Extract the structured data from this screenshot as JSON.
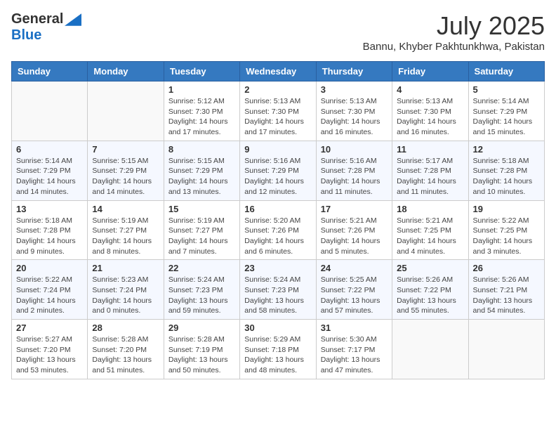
{
  "logo": {
    "general": "General",
    "blue": "Blue"
  },
  "title": "July 2025",
  "subtitle": "Bannu, Khyber Pakhtunkhwa, Pakistan",
  "days_of_week": [
    "Sunday",
    "Monday",
    "Tuesday",
    "Wednesday",
    "Thursday",
    "Friday",
    "Saturday"
  ],
  "weeks": [
    [
      {
        "day": "",
        "sunrise": "",
        "sunset": "",
        "daylight": ""
      },
      {
        "day": "",
        "sunrise": "",
        "sunset": "",
        "daylight": ""
      },
      {
        "day": "1",
        "sunrise": "Sunrise: 5:12 AM",
        "sunset": "Sunset: 7:30 PM",
        "daylight": "Daylight: 14 hours and 17 minutes."
      },
      {
        "day": "2",
        "sunrise": "Sunrise: 5:13 AM",
        "sunset": "Sunset: 7:30 PM",
        "daylight": "Daylight: 14 hours and 17 minutes."
      },
      {
        "day": "3",
        "sunrise": "Sunrise: 5:13 AM",
        "sunset": "Sunset: 7:30 PM",
        "daylight": "Daylight: 14 hours and 16 minutes."
      },
      {
        "day": "4",
        "sunrise": "Sunrise: 5:13 AM",
        "sunset": "Sunset: 7:30 PM",
        "daylight": "Daylight: 14 hours and 16 minutes."
      },
      {
        "day": "5",
        "sunrise": "Sunrise: 5:14 AM",
        "sunset": "Sunset: 7:29 PM",
        "daylight": "Daylight: 14 hours and 15 minutes."
      }
    ],
    [
      {
        "day": "6",
        "sunrise": "Sunrise: 5:14 AM",
        "sunset": "Sunset: 7:29 PM",
        "daylight": "Daylight: 14 hours and 14 minutes."
      },
      {
        "day": "7",
        "sunrise": "Sunrise: 5:15 AM",
        "sunset": "Sunset: 7:29 PM",
        "daylight": "Daylight: 14 hours and 14 minutes."
      },
      {
        "day": "8",
        "sunrise": "Sunrise: 5:15 AM",
        "sunset": "Sunset: 7:29 PM",
        "daylight": "Daylight: 14 hours and 13 minutes."
      },
      {
        "day": "9",
        "sunrise": "Sunrise: 5:16 AM",
        "sunset": "Sunset: 7:29 PM",
        "daylight": "Daylight: 14 hours and 12 minutes."
      },
      {
        "day": "10",
        "sunrise": "Sunrise: 5:16 AM",
        "sunset": "Sunset: 7:28 PM",
        "daylight": "Daylight: 14 hours and 11 minutes."
      },
      {
        "day": "11",
        "sunrise": "Sunrise: 5:17 AM",
        "sunset": "Sunset: 7:28 PM",
        "daylight": "Daylight: 14 hours and 11 minutes."
      },
      {
        "day": "12",
        "sunrise": "Sunrise: 5:18 AM",
        "sunset": "Sunset: 7:28 PM",
        "daylight": "Daylight: 14 hours and 10 minutes."
      }
    ],
    [
      {
        "day": "13",
        "sunrise": "Sunrise: 5:18 AM",
        "sunset": "Sunset: 7:28 PM",
        "daylight": "Daylight: 14 hours and 9 minutes."
      },
      {
        "day": "14",
        "sunrise": "Sunrise: 5:19 AM",
        "sunset": "Sunset: 7:27 PM",
        "daylight": "Daylight: 14 hours and 8 minutes."
      },
      {
        "day": "15",
        "sunrise": "Sunrise: 5:19 AM",
        "sunset": "Sunset: 7:27 PM",
        "daylight": "Daylight: 14 hours and 7 minutes."
      },
      {
        "day": "16",
        "sunrise": "Sunrise: 5:20 AM",
        "sunset": "Sunset: 7:26 PM",
        "daylight": "Daylight: 14 hours and 6 minutes."
      },
      {
        "day": "17",
        "sunrise": "Sunrise: 5:21 AM",
        "sunset": "Sunset: 7:26 PM",
        "daylight": "Daylight: 14 hours and 5 minutes."
      },
      {
        "day": "18",
        "sunrise": "Sunrise: 5:21 AM",
        "sunset": "Sunset: 7:25 PM",
        "daylight": "Daylight: 14 hours and 4 minutes."
      },
      {
        "day": "19",
        "sunrise": "Sunrise: 5:22 AM",
        "sunset": "Sunset: 7:25 PM",
        "daylight": "Daylight: 14 hours and 3 minutes."
      }
    ],
    [
      {
        "day": "20",
        "sunrise": "Sunrise: 5:22 AM",
        "sunset": "Sunset: 7:24 PM",
        "daylight": "Daylight: 14 hours and 2 minutes."
      },
      {
        "day": "21",
        "sunrise": "Sunrise: 5:23 AM",
        "sunset": "Sunset: 7:24 PM",
        "daylight": "Daylight: 14 hours and 0 minutes."
      },
      {
        "day": "22",
        "sunrise": "Sunrise: 5:24 AM",
        "sunset": "Sunset: 7:23 PM",
        "daylight": "Daylight: 13 hours and 59 minutes."
      },
      {
        "day": "23",
        "sunrise": "Sunrise: 5:24 AM",
        "sunset": "Sunset: 7:23 PM",
        "daylight": "Daylight: 13 hours and 58 minutes."
      },
      {
        "day": "24",
        "sunrise": "Sunrise: 5:25 AM",
        "sunset": "Sunset: 7:22 PM",
        "daylight": "Daylight: 13 hours and 57 minutes."
      },
      {
        "day": "25",
        "sunrise": "Sunrise: 5:26 AM",
        "sunset": "Sunset: 7:22 PM",
        "daylight": "Daylight: 13 hours and 55 minutes."
      },
      {
        "day": "26",
        "sunrise": "Sunrise: 5:26 AM",
        "sunset": "Sunset: 7:21 PM",
        "daylight": "Daylight: 13 hours and 54 minutes."
      }
    ],
    [
      {
        "day": "27",
        "sunrise": "Sunrise: 5:27 AM",
        "sunset": "Sunset: 7:20 PM",
        "daylight": "Daylight: 13 hours and 53 minutes."
      },
      {
        "day": "28",
        "sunrise": "Sunrise: 5:28 AM",
        "sunset": "Sunset: 7:20 PM",
        "daylight": "Daylight: 13 hours and 51 minutes."
      },
      {
        "day": "29",
        "sunrise": "Sunrise: 5:28 AM",
        "sunset": "Sunset: 7:19 PM",
        "daylight": "Daylight: 13 hours and 50 minutes."
      },
      {
        "day": "30",
        "sunrise": "Sunrise: 5:29 AM",
        "sunset": "Sunset: 7:18 PM",
        "daylight": "Daylight: 13 hours and 48 minutes."
      },
      {
        "day": "31",
        "sunrise": "Sunrise: 5:30 AM",
        "sunset": "Sunset: 7:17 PM",
        "daylight": "Daylight: 13 hours and 47 minutes."
      },
      {
        "day": "",
        "sunrise": "",
        "sunset": "",
        "daylight": ""
      },
      {
        "day": "",
        "sunrise": "",
        "sunset": "",
        "daylight": ""
      }
    ]
  ]
}
